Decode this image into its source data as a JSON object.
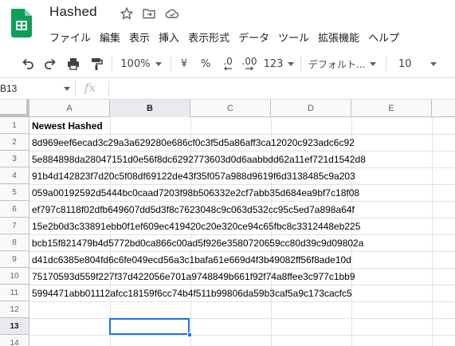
{
  "app": {
    "doc_title": "Hashed",
    "menu": [
      "ファイル",
      "編集",
      "表示",
      "挿入",
      "表示形式",
      "データ",
      "ツール",
      "拡張機能",
      "ヘルプ"
    ]
  },
  "toolbar": {
    "zoom": "100%",
    "currency": "¥",
    "percent": "%",
    "decimal_decrease": ".0",
    "decimal_increase": ".00",
    "number_format": "123",
    "font_family": "デフォルト...",
    "font_size": "10"
  },
  "formula_bar": {
    "name_box": "B13",
    "fx_label": "fx"
  },
  "grid": {
    "columns": [
      "A",
      "B",
      "C",
      "D",
      "E"
    ],
    "active_column": "B",
    "rows": [
      "1",
      "2",
      "3",
      "4",
      "5",
      "6",
      "7",
      "8",
      "9",
      "10",
      "11",
      "12",
      "13",
      "14"
    ],
    "active_row": "13",
    "cells_a": [
      "Newest Hashed",
      "8d969eef6ecad3c29a3a629280e686cf0c3f5d5a86aff3ca12020c923adc6c92",
      "5e884898da28047151d0e56f8dc6292773603d0d6aabbdd62a11ef721d1542d8",
      "91b4d142823f7d20c5f08df69122de43f35f057a988d9619f6d3138485c9a203",
      "059a00192592d5444bc0caad7203f98b506332e2cf7abb35d684ea9bf7c18f08",
      "ef797c8118f02dfb649607dd5d3f8c7623048c9c063d532cc95c5ed7a898a64f",
      "15e2b0d3c33891ebb0f1ef609ec419420c20e320ce94c65fbc8c3312448eb225",
      "bcb15f821479b4d5772bd0ca866c00ad5f926e3580720659cc80d39c9d09802a",
      "d41dc6385e804fd6c6fe049ecd56a3c1bafa61e669d4f3b49082ff56f8ade10d",
      "75170593d559f227f37d422056e701a9748849b661f92f74a8ffee3c977c1bb9",
      "5994471abb01112afcc18159f6cc74b4f511b99806da59b3caf5a9c173cacfc5"
    ]
  },
  "colors": {
    "selection": "#1a73e8",
    "sheets_green": "#0f9d58"
  }
}
